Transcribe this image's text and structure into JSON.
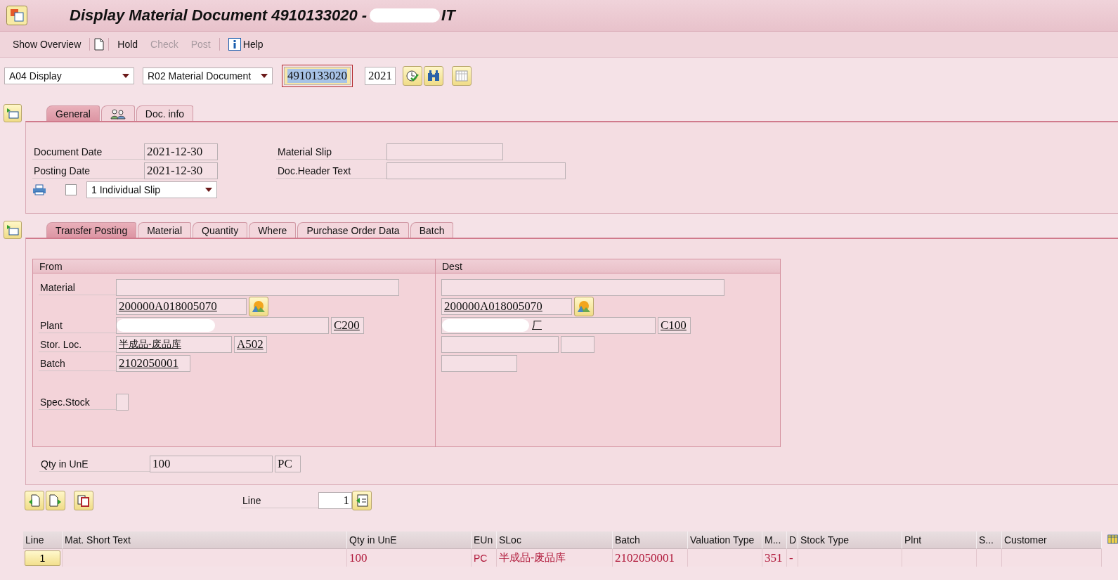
{
  "window": {
    "title": "Display Material Document 4910133020 -",
    "title_suffix": "IT"
  },
  "toolbar": [
    {
      "kind": "text",
      "label": "Show Overview",
      "disabled": false
    },
    {
      "kind": "separator"
    },
    {
      "kind": "document"
    },
    {
      "kind": "separator"
    },
    {
      "kind": "text",
      "label": "Hold",
      "disabled": false
    },
    {
      "kind": "text",
      "label": "Check",
      "disabled": true
    },
    {
      "kind": "text",
      "label": "Post",
      "disabled": true
    },
    {
      "kind": "separator"
    },
    {
      "kind": "info",
      "label": "Help",
      "disabled": false
    }
  ],
  "selectors": {
    "action": "A04 Display",
    "reference": "R02 Material Document",
    "doc_number": "4910133020",
    "doc_number_highlighted": true,
    "year": "2021"
  },
  "header_tabs": [
    {
      "kind": "text",
      "label": "General",
      "selected": true
    },
    {
      "kind": "people",
      "selected": false
    },
    {
      "kind": "text",
      "label": "Doc. info",
      "selected": false
    }
  ],
  "general": {
    "document_date": {
      "label": "Document Date",
      "value": "2021-12-30"
    },
    "posting_date": {
      "label": "Posting Date",
      "value": "2021-12-30"
    },
    "material_slip": {
      "label": "Material Slip"
    },
    "doc_header_text": {
      "label": "Doc.Header Text"
    },
    "print_checked": false,
    "print_version": "1 Individual Slip"
  },
  "item_tabs": [
    {
      "label": "Transfer Posting",
      "selected": true
    },
    {
      "label": "Material",
      "selected": false
    },
    {
      "label": "Quantity",
      "selected": false
    },
    {
      "label": "Where",
      "selected": false
    },
    {
      "label": "Purchase Order Data",
      "selected": false
    },
    {
      "label": "Batch",
      "selected": false
    }
  ],
  "from": {
    "title": "From",
    "labels": {
      "material": "Material",
      "plant": "Plant",
      "stor_loc": "Stor. Loc.",
      "batch": "Batch",
      "spec_stock": "Spec.Stock"
    },
    "material_number": "200000A018005070",
    "plant_code": "C200",
    "stor_loc_name": "半成品-废品库",
    "stor_loc_code": "A502",
    "batch": "2102050001"
  },
  "dest": {
    "title": "Dest",
    "material_number": "200000A018005070",
    "plant_name_tail": "厂",
    "plant_code": "C100"
  },
  "quantity": {
    "label": "Qty in UnE",
    "value": "100",
    "unit": "PC"
  },
  "line_nav": {
    "label": "Line",
    "value": "1"
  },
  "table": {
    "columns": [
      "Line",
      "Mat. Short Text",
      "Qty in UnE",
      "EUn",
      "SLoc",
      "Batch",
      "Valuation Type",
      "M...",
      "D",
      "Stock Type",
      "Plnt",
      "S...",
      "Customer"
    ],
    "rows": [
      {
        "cells": [
          "1",
          "",
          "100",
          "PC",
          "半成品-废品库",
          "2102050001",
          "",
          "351",
          "-",
          "",
          "",
          "",
          ""
        ]
      }
    ]
  }
}
